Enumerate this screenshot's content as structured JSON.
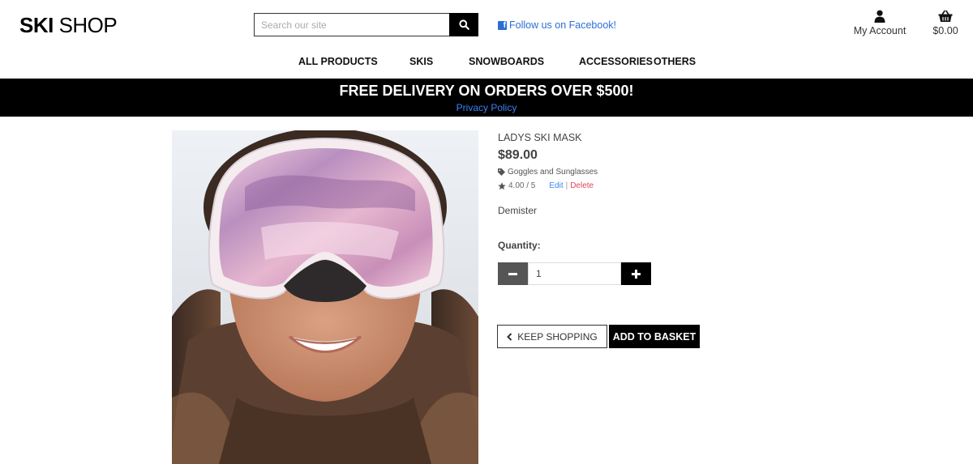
{
  "brand": {
    "part1": "SKI",
    "part2": " SHOP"
  },
  "search": {
    "placeholder": "Search our site"
  },
  "social": {
    "facebook_label": "Follow us on Facebook!"
  },
  "account": {
    "label": "My Account"
  },
  "basket": {
    "total": "$0.00"
  },
  "nav": {
    "all_products": "ALL PRODUCTS",
    "skis": "SKIS",
    "snowboards": "SNOWBOARDS",
    "accessories": "ACCESSORIES",
    "others": "OTHERS"
  },
  "banner": {
    "text": "FREE DELIVERY ON ORDERS OVER $500!",
    "link": "Privacy Policy"
  },
  "product": {
    "name": "LADYS SKI MASK",
    "price": "$89.00",
    "category": "Goggles and Sunglasses",
    "rating": "4.00 / 5",
    "edit_label": "Edit",
    "separator": "|",
    "delete_label": "Delete",
    "description": "Demister",
    "quantity_label": "Quantity:",
    "quantity_value": "1"
  },
  "actions": {
    "keep_shopping": "KEEP SHOPPING",
    "add_to_basket": "ADD TO BASKET"
  },
  "colors": {
    "link_blue": "#3b82f6",
    "delete_red": "#e0455a",
    "banner_bg": "#000000"
  }
}
